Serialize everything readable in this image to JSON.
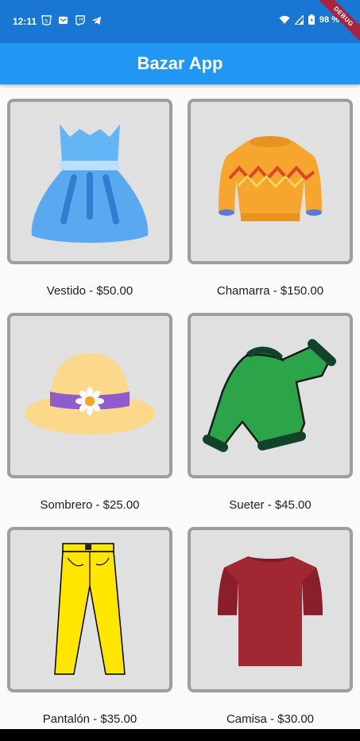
{
  "status_bar": {
    "time": "12:11",
    "battery": "98 %",
    "debug_label": "DEBUG",
    "icons": [
      "html5-icon",
      "mail-icon",
      "twitch-icon",
      "telegram-icon",
      "wifi-icon",
      "signal-icon",
      "battery-icon"
    ]
  },
  "app_bar": {
    "title": "Bazar App",
    "color": "#2196f3"
  },
  "products": [
    {
      "name": "Vestido",
      "price": "$50.00",
      "label": "Vestido - $50.00",
      "icon": "dress-icon"
    },
    {
      "name": "Chamarra",
      "price": "$150.00",
      "label": "Chamarra - $150.00",
      "icon": "jacket-icon"
    },
    {
      "name": "Sombrero",
      "price": "$25.00",
      "label": "Sombrero - $25.00",
      "icon": "hat-icon"
    },
    {
      "name": "Sueter",
      "price": "$45.00",
      "label": "Sueter - $45.00",
      "icon": "sweater-icon"
    },
    {
      "name": "Pantalón",
      "price": "$35.00",
      "label": "Pantalón - $35.00",
      "icon": "pants-icon"
    },
    {
      "name": "Camisa",
      "price": "$30.00",
      "label": "Camisa - $30.00",
      "icon": "shirt-icon"
    }
  ]
}
